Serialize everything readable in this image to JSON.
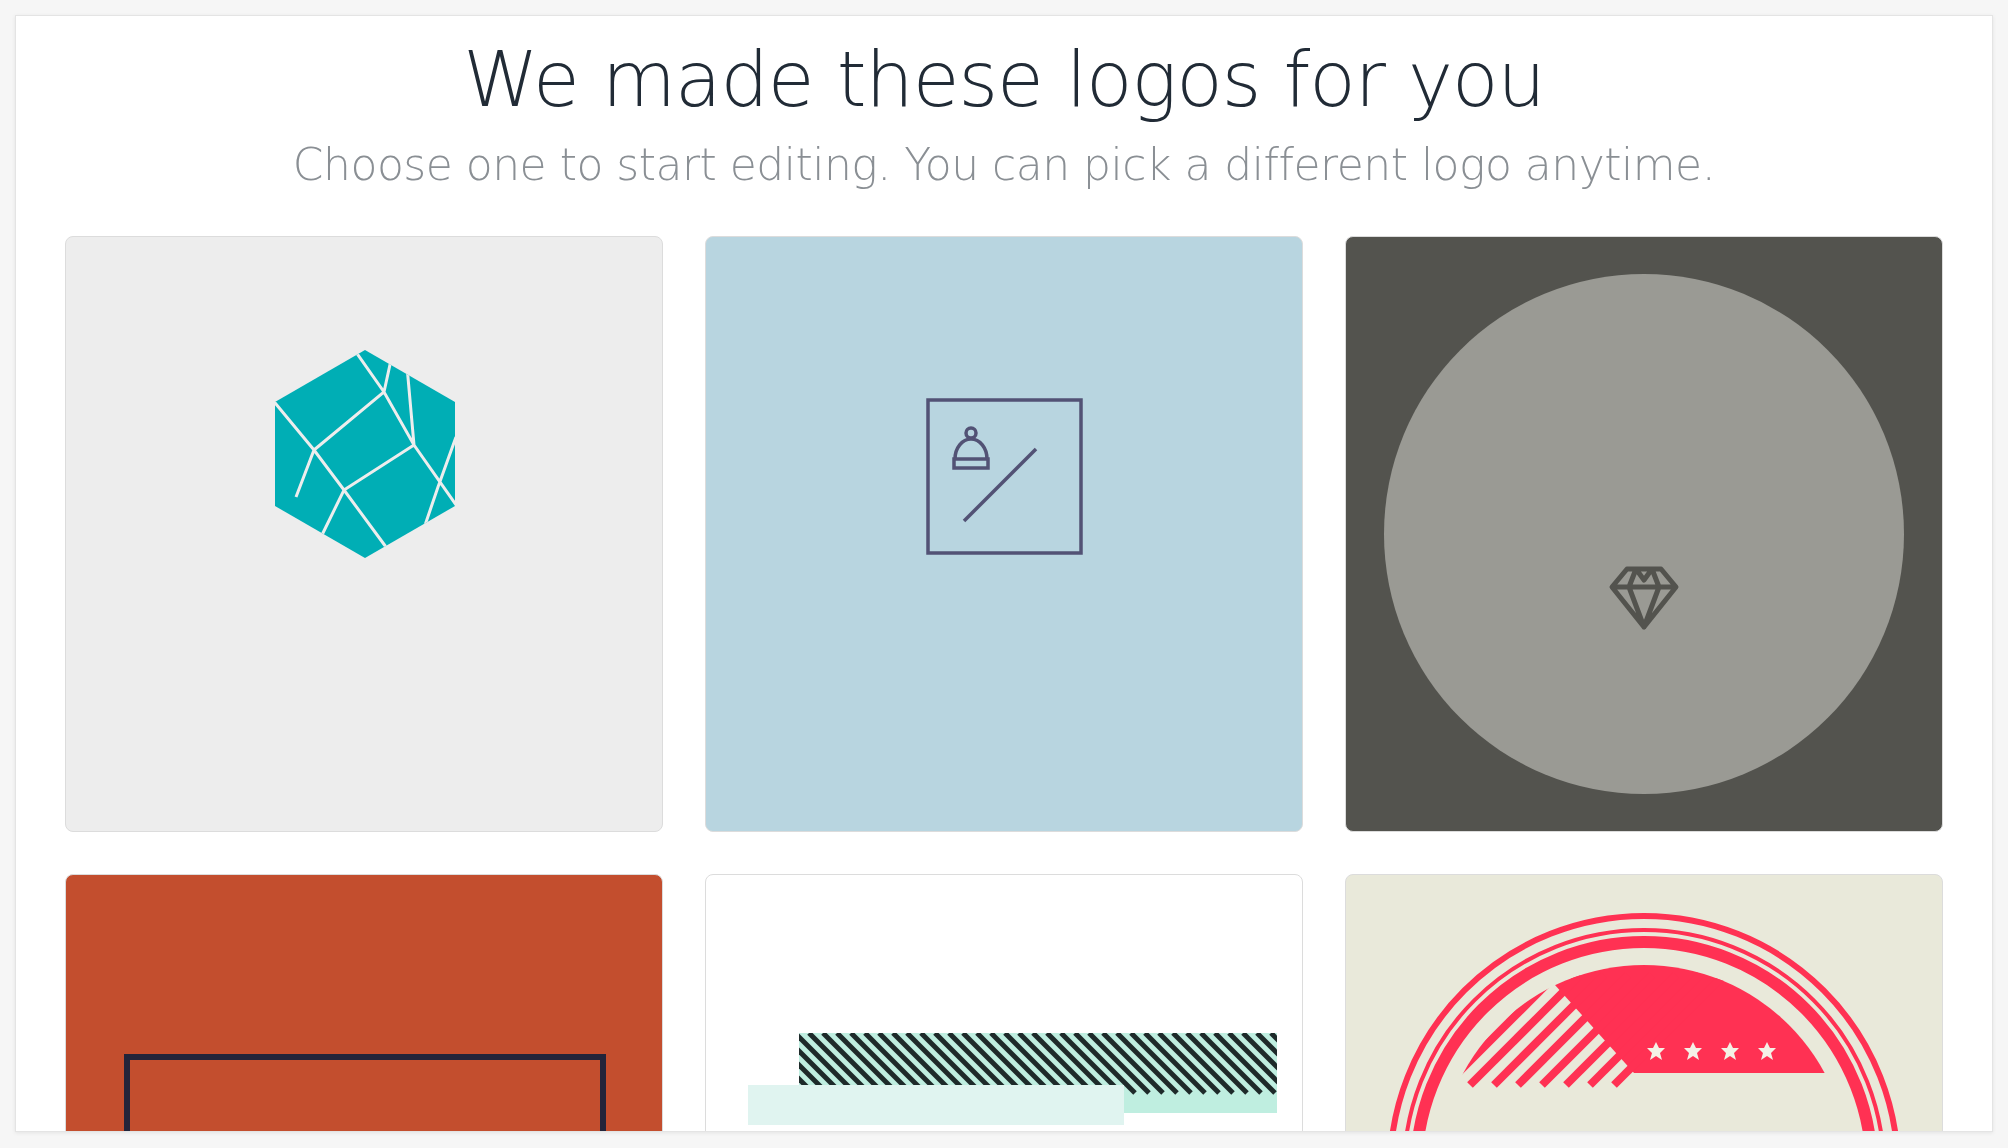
{
  "heading": {
    "title": "We made these logos for you",
    "subtitle": "Choose one to start editing. You can pick a different logo anytime."
  },
  "logos": [
    {
      "kind": "hexagon"
    },
    {
      "kind": "hat-frame"
    },
    {
      "kind": "diamond-circle"
    },
    {
      "kind": "frame"
    },
    {
      "kind": "stripes"
    },
    {
      "kind": "badge"
    }
  ]
}
